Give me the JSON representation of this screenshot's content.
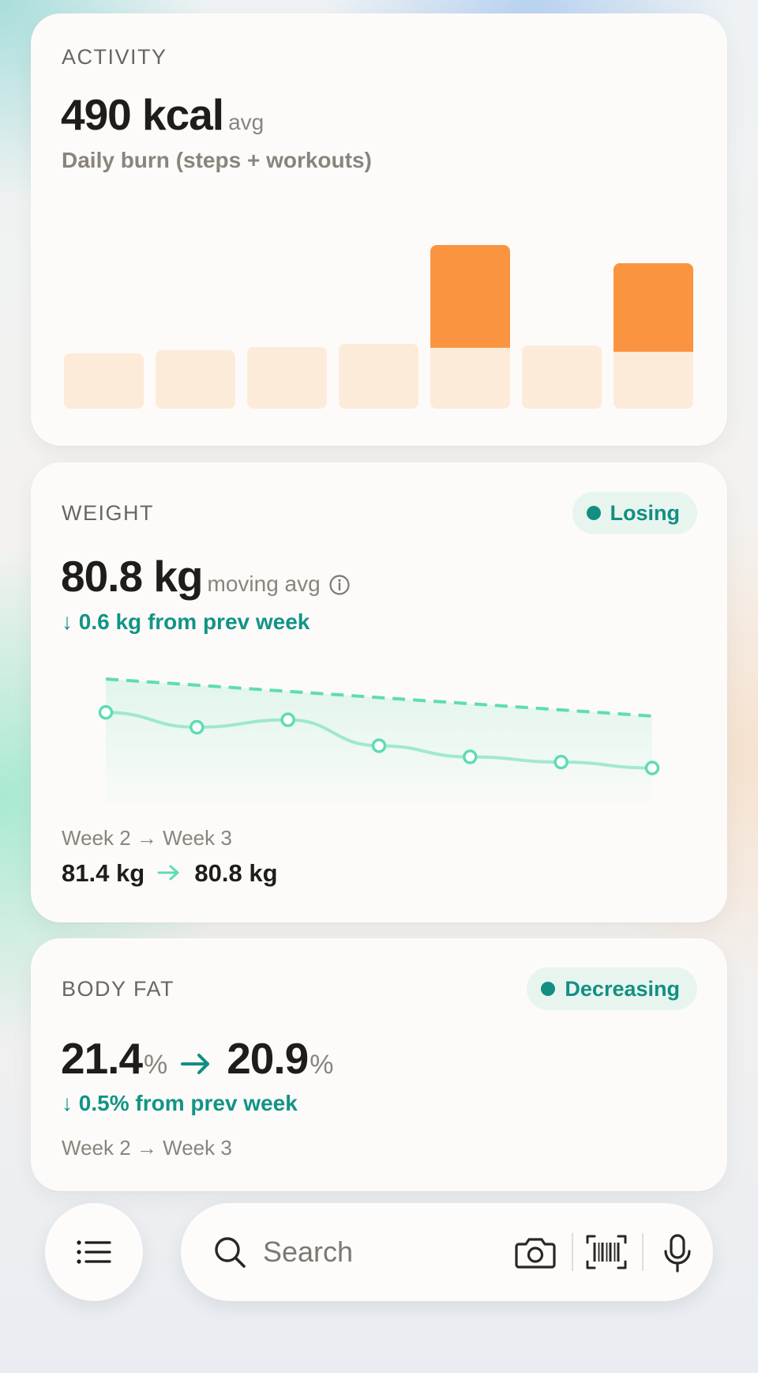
{
  "activity": {
    "label": "ACTIVITY",
    "value": "490 kcal",
    "value_suffix": "avg",
    "subtitle": "Daily burn (steps + workouts)",
    "colors": {
      "base": "#fdebd9",
      "workout": "#fb9440"
    },
    "days": [
      {
        "steps": 70,
        "workout": 0
      },
      {
        "steps": 74,
        "workout": 0
      },
      {
        "steps": 78,
        "workout": 0
      },
      {
        "steps": 82,
        "workout": 0
      },
      {
        "steps": 77,
        "workout": 130
      },
      {
        "steps": 80,
        "workout": 0
      },
      {
        "steps": 72,
        "workout": 112
      }
    ]
  },
  "weight": {
    "label": "WEIGHT",
    "badge": "Losing",
    "value": "80.8 kg",
    "value_suffix": "moving avg",
    "delta": "↓ 0.6 kg from prev week",
    "weeks": "Week 2 → Week 3",
    "from": "81.4 kg",
    "to": "80.8 kg",
    "trend_color": "#5fdcb3",
    "points": [
      81.4,
      81.2,
      81.3,
      80.95,
      80.8,
      80.73,
      80.65
    ],
    "target_line": [
      81.85,
      81.35
    ]
  },
  "bodyfat": {
    "label": "BODY FAT",
    "badge": "Decreasing",
    "from_value": "21.4",
    "to_value": "20.9",
    "unit": "%",
    "delta": "↓ 0.5% from prev week",
    "weeks": "Week 2 → Week 3"
  },
  "bottom": {
    "search_placeholder": "Search",
    "icons": [
      "list-icon",
      "search-icon",
      "camera-icon",
      "barcode-icon",
      "microphone-icon"
    ]
  }
}
